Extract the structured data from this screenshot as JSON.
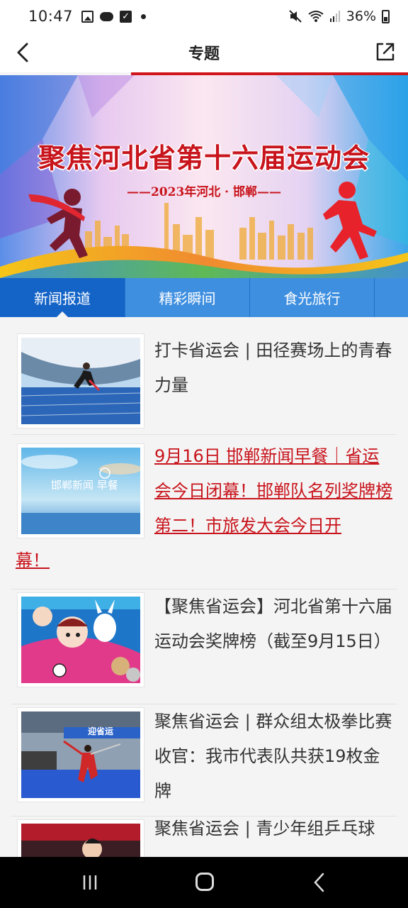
{
  "status_bar": {
    "time": "10:47",
    "battery": "36%",
    "icons": [
      "gallery-icon",
      "cloud-icon",
      "check-icon",
      "dot-icon",
      "mute-icon",
      "wifi-icon",
      "signal-icon",
      "battery-icon"
    ]
  },
  "header": {
    "title": "专题",
    "back_icon": "chevron-left-icon",
    "share_icon": "share-icon"
  },
  "banner": {
    "title": "聚焦河北省第十六届运动会",
    "subtitle": "——2023年河北 · 邯郸——"
  },
  "tabs": [
    {
      "label": "新闻报道",
      "active": true
    },
    {
      "label": "精彩瞬间",
      "active": false
    },
    {
      "label": "食光旅行",
      "active": false
    },
    {
      "label": "",
      "active": false
    }
  ],
  "news": [
    {
      "title": "打卡省运会 | 田径赛场上的青春力量",
      "thumb_caption": "",
      "highlighted": false
    },
    {
      "title": "9月16日 邯郸新闻早餐｜省运会今日闭幕！邯郸队名列奖牌榜第二！市旅发大会今日开",
      "title_rest": "幕！",
      "thumb_caption": "邯郸新闻 早餐",
      "highlighted": true
    },
    {
      "title": "【聚焦省运会】河北省第十六届运动会奖牌榜（截至9月15日）",
      "thumb_caption": "",
      "highlighted": false
    },
    {
      "title": "聚焦省运会 | 群众组太极拳比赛收官：我市代表队共获19枚金牌",
      "thumb_caption": "迎省运",
      "highlighted": false
    },
    {
      "title": "聚焦省运会 | 青少年组乒乓球",
      "thumb_caption": "",
      "highlighted": false
    }
  ],
  "colors": {
    "accent_red": "#c8141c",
    "tab_blue": "#3f8fe0",
    "tab_active_blue": "#1464c8"
  }
}
